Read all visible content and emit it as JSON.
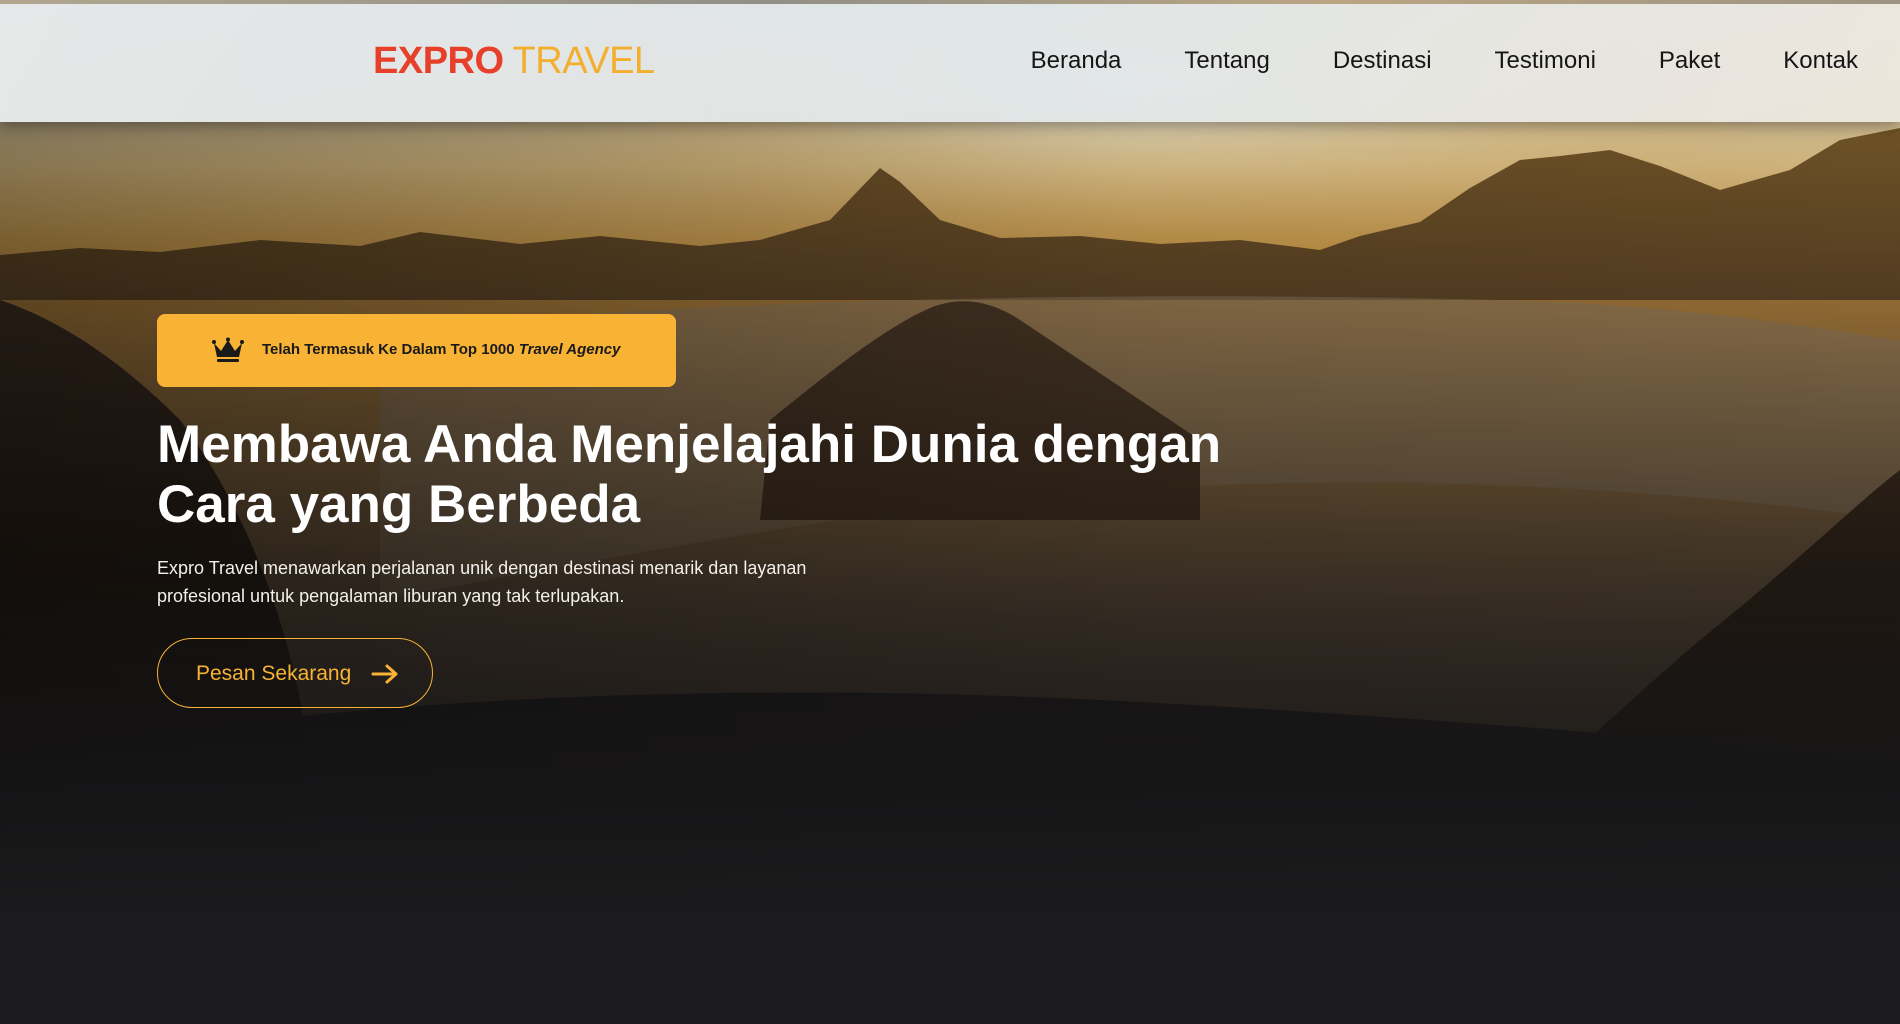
{
  "brand": {
    "name_part1": "EXPRO",
    "name_part2": "TRAVEL"
  },
  "nav": {
    "items": [
      {
        "label": "Beranda"
      },
      {
        "label": "Tentang"
      },
      {
        "label": "Destinasi"
      },
      {
        "label": "Testimoni"
      },
      {
        "label": "Paket"
      },
      {
        "label": "Kontak"
      }
    ]
  },
  "hero": {
    "badge": {
      "icon": "crown-icon",
      "text_plain": "Telah Termasuk Ke Dalam Top 1000 ",
      "text_italic": "Travel Agency"
    },
    "headline_line1": "Membawa Anda Menjelajahi Dunia dengan",
    "headline_line2": "Cara yang Berbeda",
    "description_line1": "Expro Travel menawarkan perjalanan unik dengan destinasi menarik dan layanan",
    "description_line2": "profesional untuk pengalaman liburan yang tak terlupakan.",
    "cta_label": "Pesan Sekarang",
    "cta_icon": "arrow-right-icon"
  },
  "colors": {
    "brand_red": "#e6402a",
    "brand_orange": "#f4ae2e",
    "accent": "#f8b234",
    "page_bg": "#1b1b1d"
  }
}
